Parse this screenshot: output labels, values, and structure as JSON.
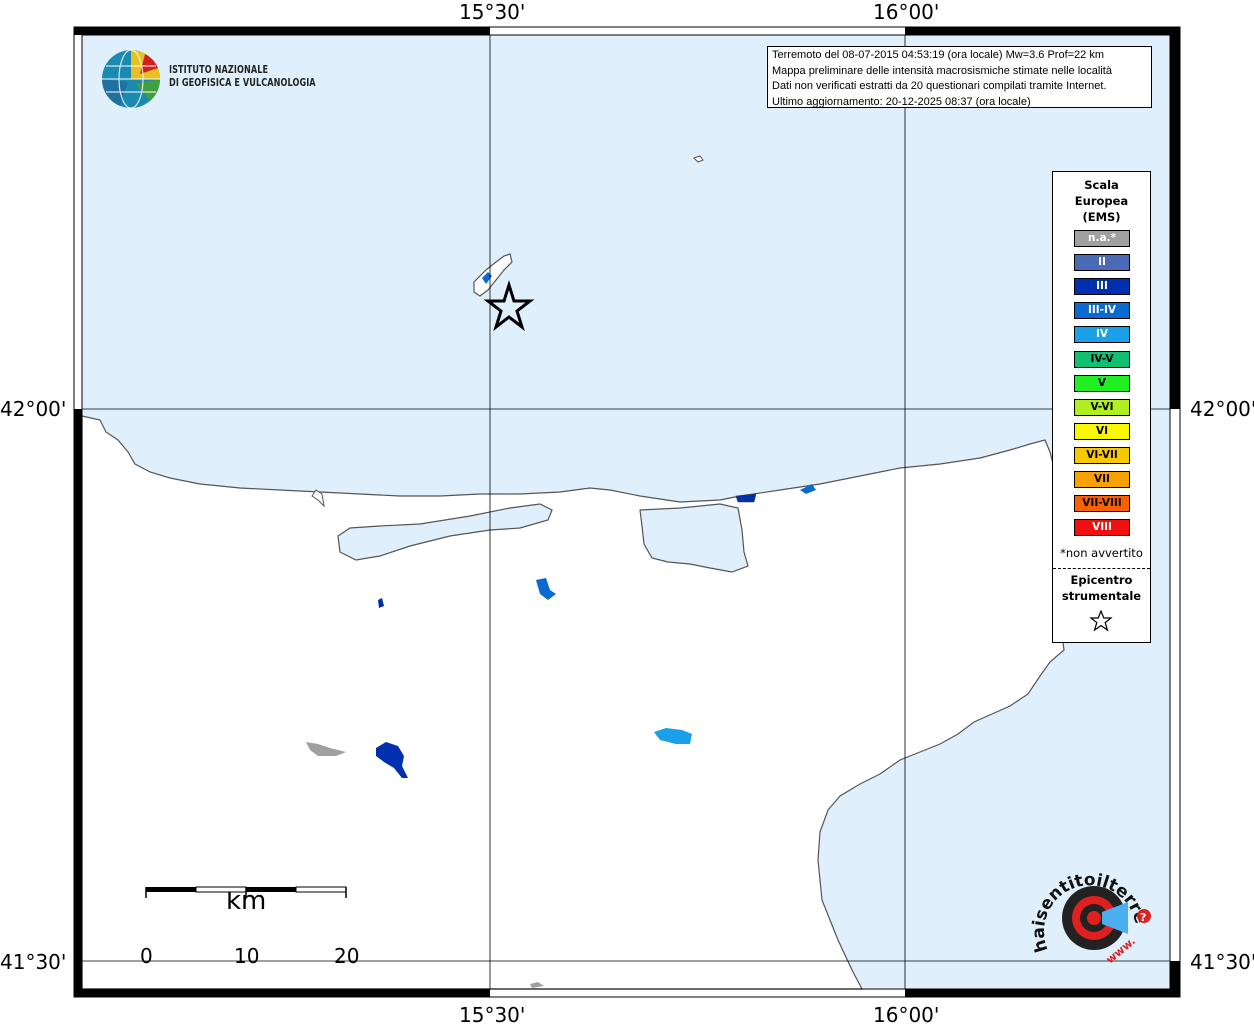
{
  "map": {
    "lon_labels": [
      "15°30'",
      "16°00'"
    ],
    "lat_labels": [
      "42°00'",
      "41°30'"
    ],
    "colors": {
      "sea": "#dff0fc",
      "land": "#ffffff",
      "coast": "#555555",
      "grid": "#000000"
    }
  },
  "institute": {
    "line1": "ISTITUTO NAZIONALE",
    "line2": "DI GEOFISICA E VULCANOLOGIA"
  },
  "info": {
    "line1": "Terremoto del 08-07-2015 04:53:19 (ora locale) Mw=3.6 Prof=22 km",
    "line2": "Mappa preliminare delle intensità macrosismiche stimate nelle località",
    "line3": "Dati non verificati estratti da 20 questionari compilati tramite Internet.",
    "line4": "Ultimo aggiornamento: 20-12-2025 08:37 (ora locale)"
  },
  "legend": {
    "title_lines": [
      "Scala",
      "Europea",
      "(EMS)"
    ],
    "items": [
      {
        "label": "n.a.*",
        "color": "#a0a0a0",
        "text_color": "#ffffff"
      },
      {
        "label": "II",
        "color": "#4a6ab5",
        "text_color": "#ffffff"
      },
      {
        "label": "III",
        "color": "#0030b0",
        "text_color": "#ffffff"
      },
      {
        "label": "III-IV",
        "color": "#0a6ad0",
        "text_color": "#ffffff"
      },
      {
        "label": "IV",
        "color": "#1aa0e8",
        "text_color": "#ffffff"
      },
      {
        "label": "IV-V",
        "color": "#10c070",
        "text_color": "#000000"
      },
      {
        "label": "V",
        "color": "#20f020",
        "text_color": "#000000"
      },
      {
        "label": "V-VI",
        "color": "#b0f020",
        "text_color": "#000000"
      },
      {
        "label": "VI",
        "color": "#f8f800",
        "text_color": "#000000"
      },
      {
        "label": "VI-VII",
        "color": "#f8c800",
        "text_color": "#000000"
      },
      {
        "label": "VII",
        "color": "#f8a000",
        "text_color": "#000000"
      },
      {
        "label": "VII-VIII",
        "color": "#f86000",
        "text_color": "#000000"
      },
      {
        "label": "VIII",
        "color": "#f01010",
        "text_color": "#ffffff"
      }
    ],
    "na_note": "*non avvertito",
    "epicenter_lines": [
      "Epicentro",
      "strumentale"
    ]
  },
  "scalebar": {
    "unit": "km",
    "ticks": [
      "0",
      "10",
      "20"
    ]
  },
  "haisentito": {
    "text": "haisentitoilterremoto.it",
    "www": "www."
  }
}
